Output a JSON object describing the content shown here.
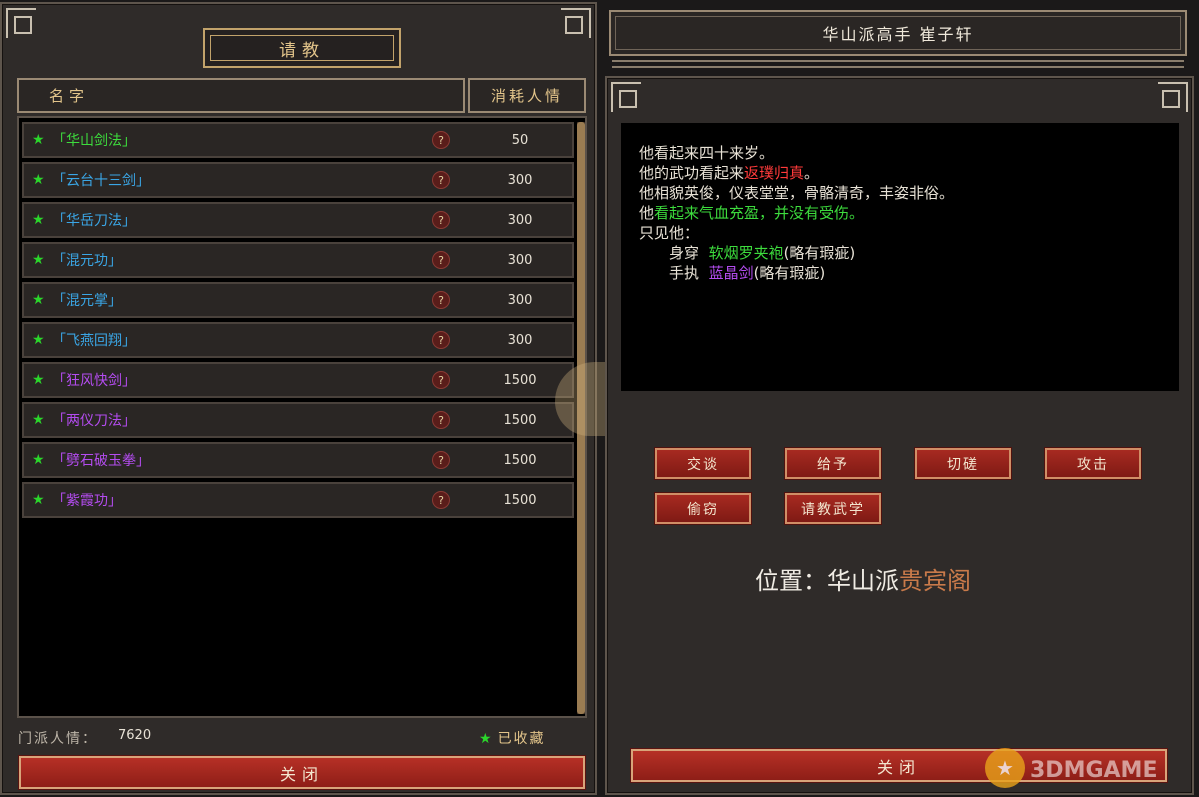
{
  "left": {
    "title": "请教",
    "header_name": "名字",
    "header_cost": "消耗人情",
    "skills": [
      {
        "name": "「华山剑法」",
        "cost": "50",
        "color": "#3ddc3d"
      },
      {
        "name": "「云台十三剑」",
        "cost": "300",
        "color": "#3aa6e6"
      },
      {
        "name": "「华岳刀法」",
        "cost": "300",
        "color": "#3aa6e6"
      },
      {
        "name": "「混元功」",
        "cost": "300",
        "color": "#3aa6e6"
      },
      {
        "name": "「混元掌」",
        "cost": "300",
        "color": "#3aa6e6"
      },
      {
        "name": "「飞燕回翔」",
        "cost": "300",
        "color": "#3aa6e6"
      },
      {
        "name": "「狂风快剑」",
        "cost": "1500",
        "color": "#b44cf0"
      },
      {
        "name": "「两仪刀法」",
        "cost": "1500",
        "color": "#b44cf0"
      },
      {
        "name": "「劈石破玉拳」",
        "cost": "1500",
        "color": "#b44cf0"
      },
      {
        "name": "「紫霞功」",
        "cost": "1500",
        "color": "#b44cf0"
      }
    ],
    "help_glyph": "?",
    "star_glyph": "★",
    "sect_label": "门派人情：",
    "sect_value": "7620",
    "favorited": "已收藏",
    "close": "关闭"
  },
  "right": {
    "npc_name": "华山派高手  崔子轩",
    "desc": {
      "l1": "他看起来四十来岁。",
      "l2_a": "他的武功看起来",
      "l2_b": "返璞归真",
      "l2_c": "。",
      "l3": "他相貌英俊，仪表堂堂，骨骼清奇，丰姿非俗。",
      "l4_a": "他",
      "l4_b": "看起来气血充盈，并没有受伤。",
      "l5": "只见他：",
      "wear_label": "身穿",
      "wear_item": "软烟罗夹袍",
      "wear_cond": "(略有瑕疵)",
      "hold_label": "手执",
      "hold_item": "蓝晶剑",
      "hold_cond": "(略有瑕疵)"
    },
    "actions": [
      "交谈",
      "给予",
      "切磋",
      "攻击",
      "偷窃",
      "请教武学"
    ],
    "location_prefix": "位置：华山派",
    "location_place": "贵宾阁",
    "close": "关闭"
  },
  "watermark": "3DMGAME"
}
